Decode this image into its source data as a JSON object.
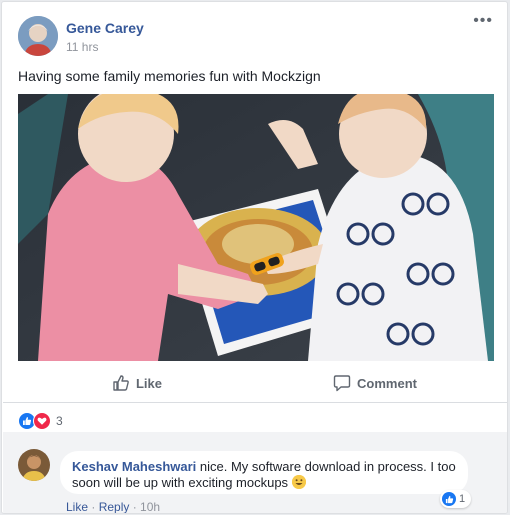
{
  "post": {
    "author": "Gene Carey",
    "time": "11 hrs",
    "text": "Having some family memories fun with Mockzign",
    "more_label": "•••"
  },
  "actions": {
    "like": "Like",
    "comment": "Comment"
  },
  "reactions": {
    "count": "3",
    "icons": [
      "like-icon",
      "love-icon"
    ]
  },
  "comment": {
    "author": "Keshav Maheshwari",
    "text": "nice. My software download in process. I too soon will be up with exciting mockups",
    "like_count": "1",
    "meta": {
      "like": "Like",
      "sep1": " · ",
      "reply": "Reply",
      "sep2": " · ",
      "time": "10h"
    }
  },
  "colors": {
    "link": "#365899",
    "like_blue": "#1877f2",
    "love_red": "#f0284a",
    "muted": "#90949c"
  }
}
